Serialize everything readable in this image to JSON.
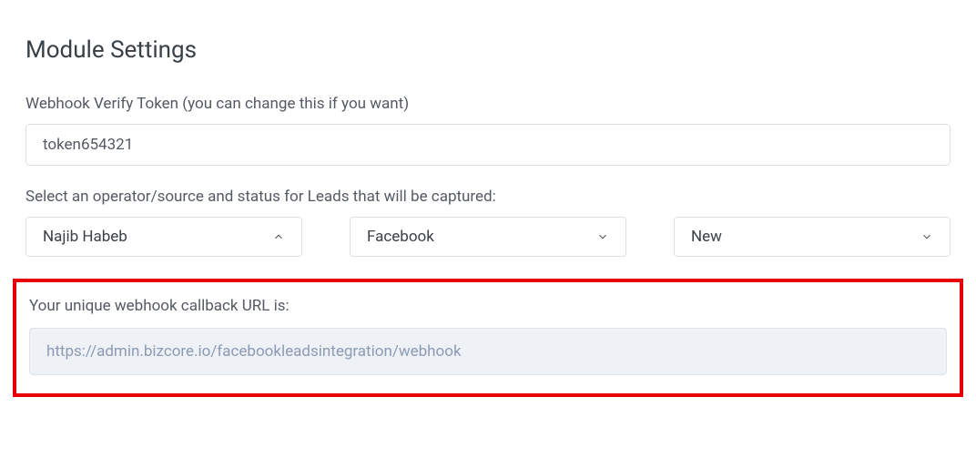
{
  "header": {
    "title": "Module Settings"
  },
  "token_field": {
    "label": "Webhook Verify Token (you can change this if you want)",
    "value": "token654321"
  },
  "select_section": {
    "label": "Select an operator/source and status for Leads that will be captured:",
    "operator": {
      "value": "Najib Habeb"
    },
    "source": {
      "value": "Facebook"
    },
    "status": {
      "value": "New"
    }
  },
  "callback": {
    "label": "Your unique webhook callback URL is:",
    "url": "https://admin.bizcore.io/facebookleadsintegration/webhook"
  }
}
